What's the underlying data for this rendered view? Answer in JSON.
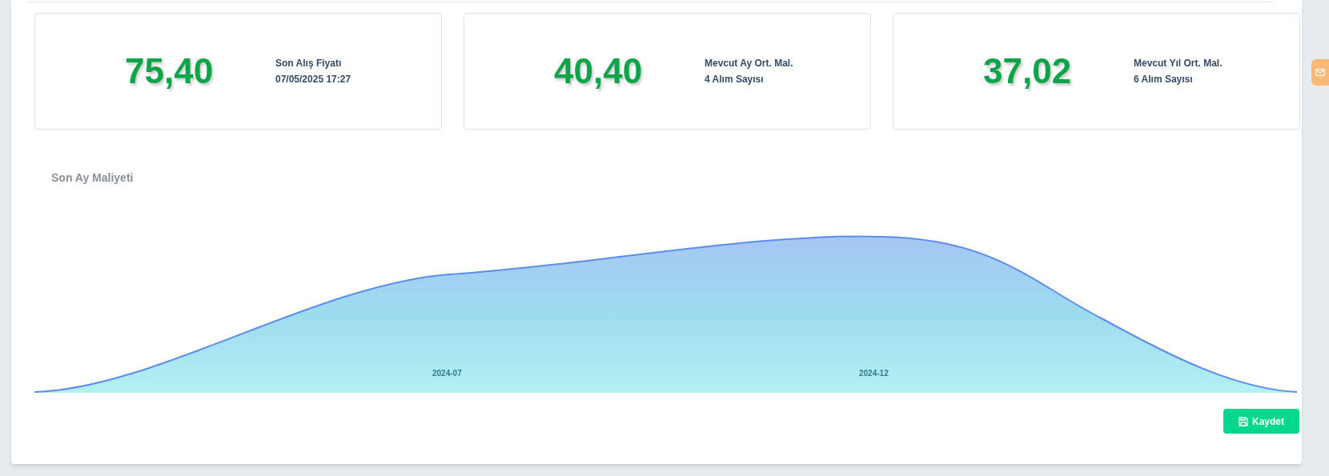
{
  "cards": [
    {
      "value": "75,40",
      "lines": [
        "Son Alış Fiyatı",
        "07/05/2025 17:27"
      ]
    },
    {
      "value": "40,40",
      "lines": [
        "Mevcut Ay Ort. Mal.",
        "4 Alım Sayısı"
      ]
    },
    {
      "value": "37,02",
      "lines": [
        "Mevcut Yıl Ort. Mal.",
        "6 Alım Sayısı"
      ]
    }
  ],
  "chart": {
    "title": "Son Ay Maliyeti",
    "x_labels": [
      "2024-07",
      "2024-12"
    ]
  },
  "save_button": {
    "label": "Kaydet"
  }
}
